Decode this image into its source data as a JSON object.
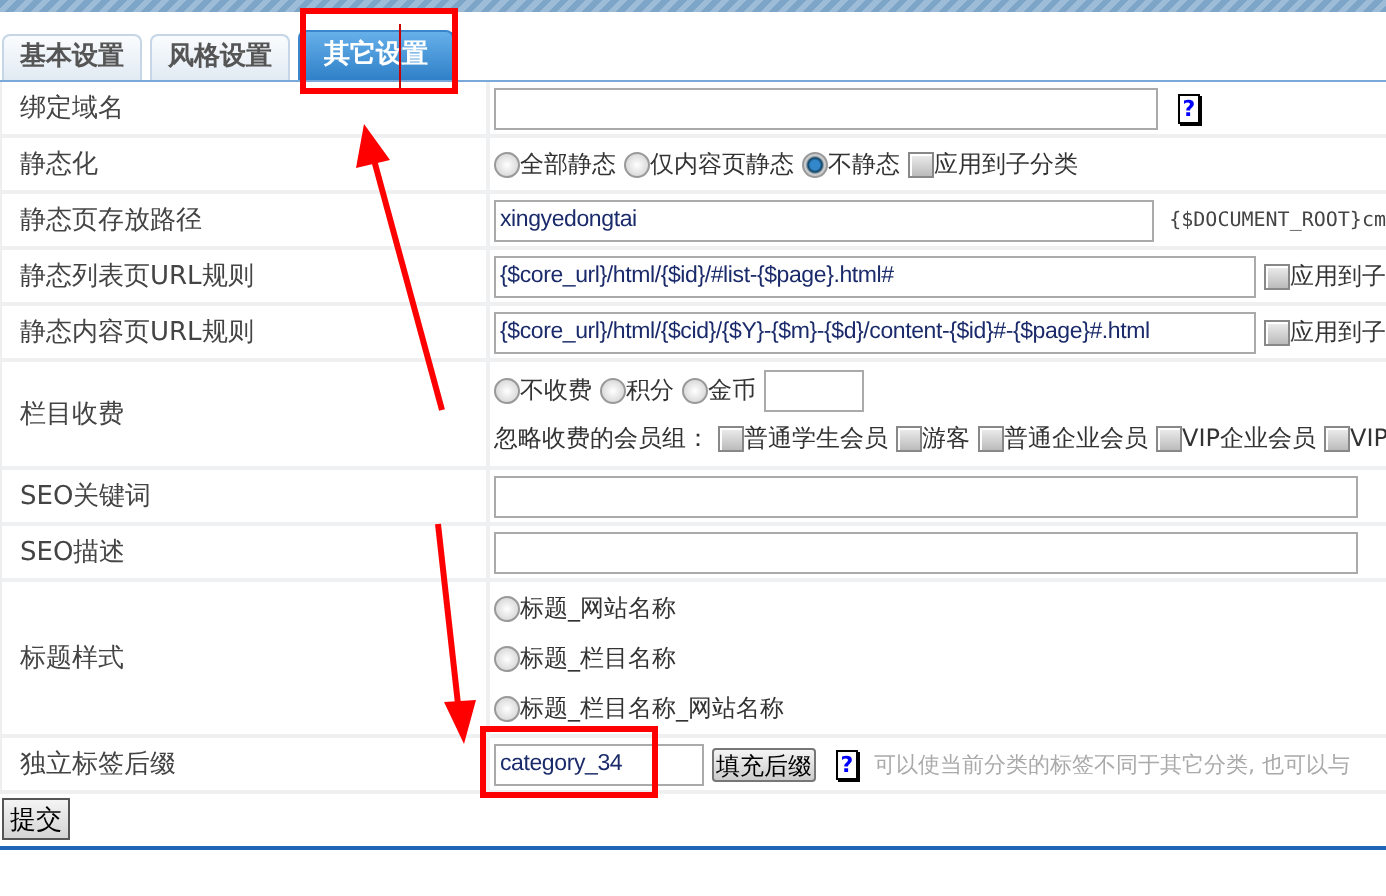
{
  "tabs": [
    {
      "label": "基本设置",
      "selected": false
    },
    {
      "label": "风格设置",
      "selected": false
    },
    {
      "label": "其它设置",
      "selected": true
    }
  ],
  "rows": [
    {
      "kind": "text",
      "label": "绑定域名",
      "help": "?"
    },
    {
      "kind": "radios",
      "label": "静态化",
      "options": [
        {
          "label": "全部静态",
          "selected": false
        },
        {
          "label": "仅内容页静态",
          "selected": false
        },
        {
          "label": "不静态",
          "selected": true
        }
      ],
      "checkbox": {
        "label": "应用到子分类",
        "checked": false
      }
    },
    {
      "kind": "text",
      "label": "静态页存放路径",
      "value": "xingyedongtai",
      "note": "{$DOCUMENT_ROOT}cm"
    },
    {
      "kind": "text",
      "label": "静态列表页URL规则",
      "value": "{$core_url}/html/{$id}/#list-{$page}.html#",
      "checkbox": {
        "label": "应用到子",
        "checked": false
      }
    },
    {
      "kind": "text",
      "label": "静态内容页URL规则",
      "value": "{$core_url}/html/{$cid}/{$Y}-{$m}-{$d}/content-{$id}#-{$page}#.html",
      "checkbox": {
        "label": "应用到子",
        "checked": false
      }
    },
    {
      "kind": "fee",
      "label": "栏目收费",
      "options": [
        {
          "label": "不收费",
          "selected": false
        },
        {
          "label": "积分",
          "selected": false
        },
        {
          "label": "金币",
          "selected": false
        }
      ],
      "group_label": "忽略收费的会员组：",
      "groups": [
        {
          "label": "普通学生会员",
          "checked": false
        },
        {
          "label": "游客",
          "checked": false
        },
        {
          "label": "普通企业会员",
          "checked": false
        },
        {
          "label": "VIP企业会员",
          "checked": false
        },
        {
          "label": "VIP",
          "checked": false
        }
      ]
    },
    {
      "kind": "text",
      "label": "SEO关键词"
    },
    {
      "kind": "text",
      "label": "SEO描述"
    },
    {
      "kind": "radio-list",
      "label": "标题样式",
      "options": [
        {
          "label": "标题_网站名称",
          "selected": false
        },
        {
          "label": "标题_栏目名称",
          "selected": false
        },
        {
          "label": "标题_栏目名称_网站名称",
          "selected": false
        }
      ]
    },
    {
      "kind": "suffix",
      "label": "独立标签后缀",
      "value": "category_34",
      "button": "填充后缀",
      "help": "?",
      "note": "可以使当前分类的标签不同于其它分类, 也可以与"
    }
  ],
  "submit": "提交"
}
